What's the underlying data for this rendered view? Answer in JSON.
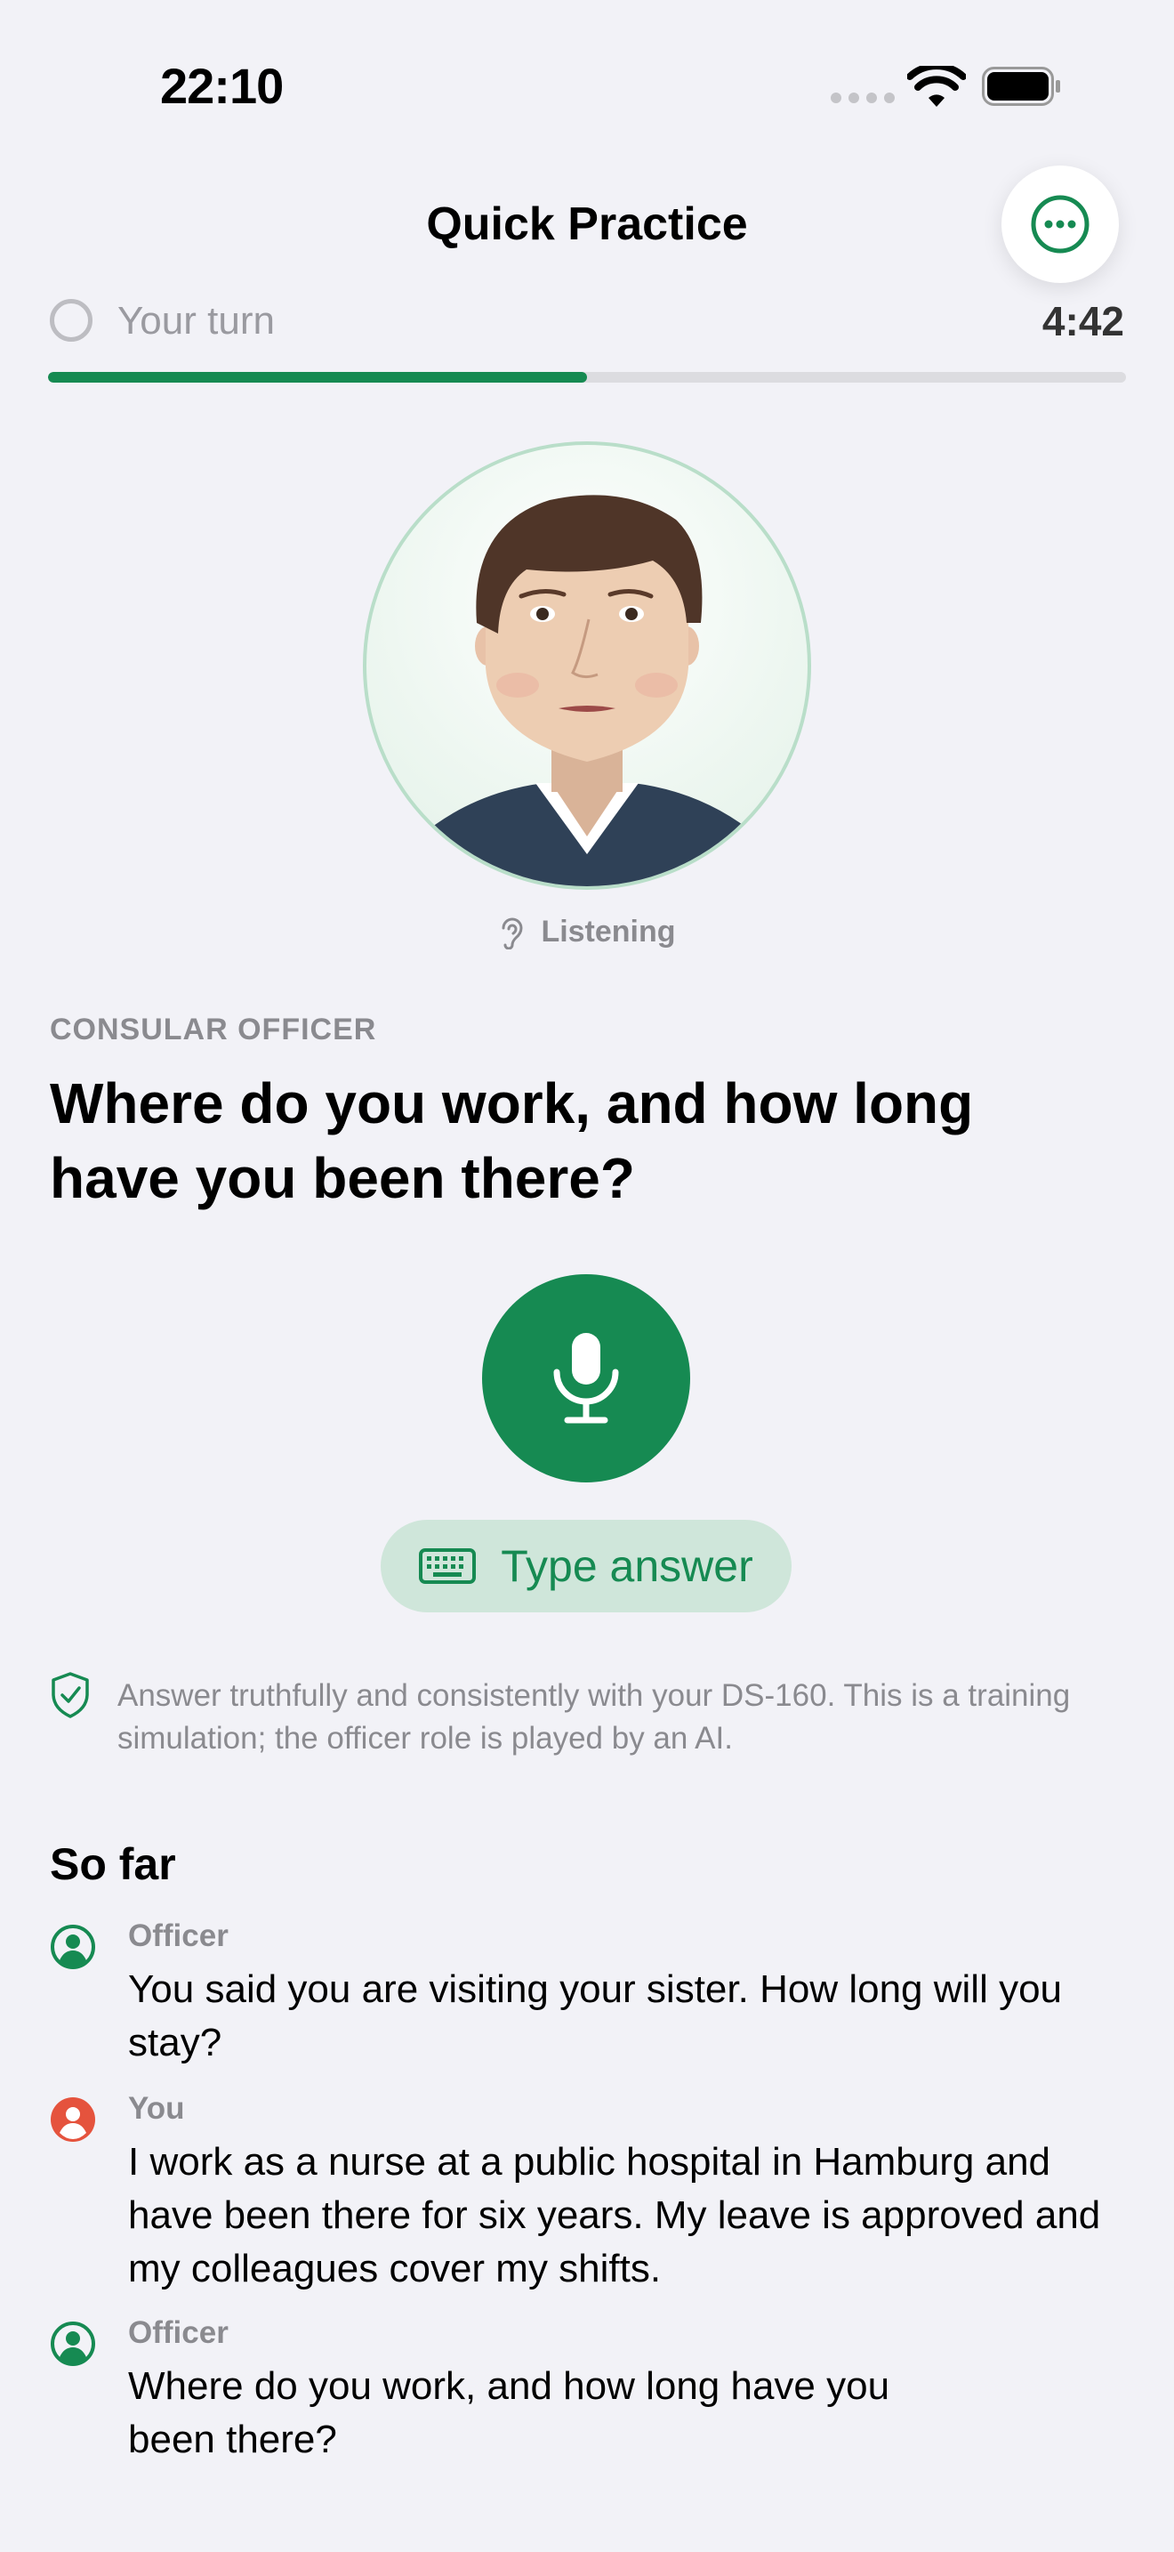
{
  "status_bar": {
    "time": "22:10"
  },
  "nav": {
    "title": "Quick Practice",
    "menu_icon": "ellipsis-circle-icon"
  },
  "session": {
    "turn_label": "Your turn",
    "timer": "4:42",
    "progress": 0.5
  },
  "officer": {
    "state_label": "Listening",
    "role_label": "CONSULAR OFFICER",
    "question": "Where do you work, and how long have you been there?"
  },
  "actions": {
    "type_answer_label": "Type answer"
  },
  "disclaimer": "Answer truthfully and consistently with your DS-160. This is a training simulation; the officer role is played by an AI.",
  "transcript": {
    "heading": "So far",
    "entries": [
      {
        "speaker": "Officer",
        "text": "You said you are visiting your sister. How long will you stay?"
      },
      {
        "speaker": "You",
        "text": "I work as a nurse at a public hospital in Hamburg and have been there for six years. My leave is approved and my colleagues cover my shifts."
      },
      {
        "speaker": "Officer",
        "text": "Where do you work, and how long have you been there?"
      }
    ]
  },
  "colors": {
    "accent": "#168A52",
    "user": "#E5533D",
    "background": "#F2F2F7"
  }
}
